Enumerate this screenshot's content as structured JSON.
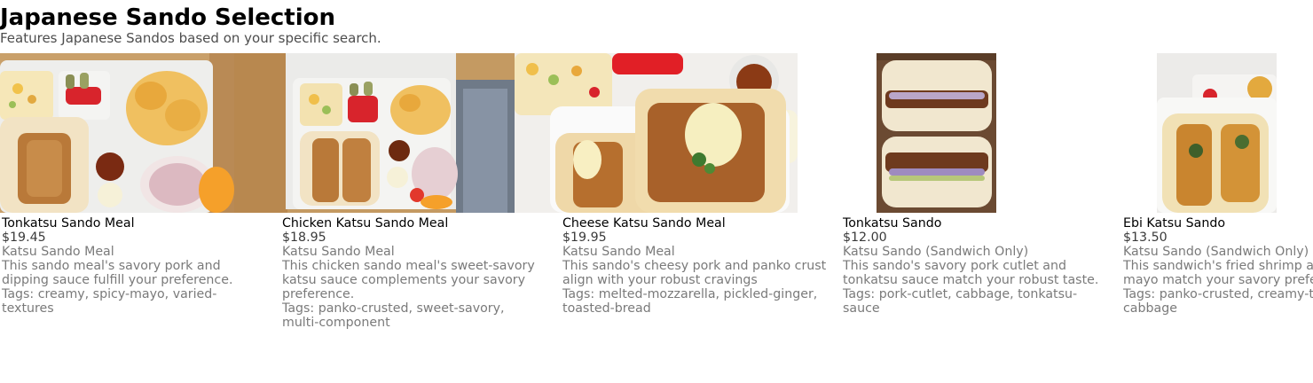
{
  "page": {
    "title": "Japanese Sando Selection",
    "subtitle": "Features Japanese Sandos based on your specific search."
  },
  "products": [
    {
      "name": "Tonkatsu Sando Meal",
      "price": "$19.45",
      "category": "Katsu Sando Meal",
      "description_lines": [
        "This sando meal's savory pork and",
        "dipping sauce fulfill your preference."
      ],
      "tags_lines": [
        "Tags: creamy, spicy-mayo, varied-",
        "textures"
      ],
      "image_icon": "bento-meal-photo"
    },
    {
      "name": "Chicken Katsu Sando Meal",
      "price": "$18.95",
      "category": "Katsu Sando Meal",
      "description_lines": [
        "This chicken sando meal's sweet-savory",
        "katsu sauce complements your savory",
        "preference."
      ],
      "tags_lines": [
        "Tags: panko-crusted, sweet-savory,",
        "multi-component"
      ],
      "image_icon": "bento-meal-photo"
    },
    {
      "name": "Cheese Katsu Sando Meal",
      "price": "$19.95",
      "category": "Katsu Sando Meal",
      "description_lines": [
        "This sando's cheesy pork and panko crust",
        "align with your robust cravings"
      ],
      "tags_lines": [
        "Tags: melted-mozzarella, pickled-ginger,",
        "toasted-bread"
      ],
      "image_icon": "cheese-sando-photo"
    },
    {
      "name": "Tonkatsu Sando",
      "price": "$12.00",
      "category": "Katsu Sando (Sandwich Only)",
      "description_lines": [
        "This sando's savory pork cutlet and",
        "tonkatsu sauce match your robust taste."
      ],
      "tags_lines": [
        "Tags: pork-cutlet, cabbage, tonkatsu-",
        "sauce"
      ],
      "image_icon": "sandwich-photo"
    },
    {
      "name": "Ebi Katsu Sando",
      "price": "$13.50",
      "category": "Katsu Sando (Sandwich Only)",
      "description_lines": [
        "This sandwich's fried shrimp and",
        "mayo match your savory preference."
      ],
      "tags_lines": [
        "Tags: panko-crusted, creamy-tartar,",
        "cabbage"
      ],
      "image_icon": "shrimp-sando-photo"
    }
  ]
}
